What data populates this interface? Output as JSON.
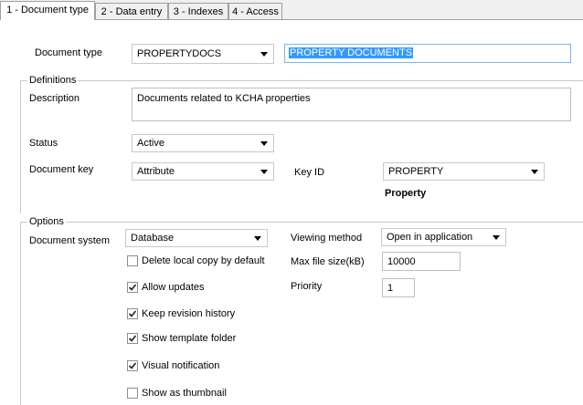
{
  "tabs": [
    {
      "label": "1 - Document type",
      "active": true
    },
    {
      "label": "2 - Data entry",
      "active": false
    },
    {
      "label": "3 - Indexes",
      "active": false
    },
    {
      "label": "4 - Access",
      "active": false
    }
  ],
  "doc_type": {
    "label": "Document type",
    "code": "PROPERTYDOCS",
    "name": "PROPERTY DOCUMENTS"
  },
  "definitions": {
    "legend": "Definitions",
    "description_label": "Description",
    "description_value": "Documents related to KCHA properties",
    "status_label": "Status",
    "status_value": "Active",
    "doc_key_label": "Document key",
    "doc_key_value": "Attribute",
    "key_id_label": "Key ID",
    "key_id_value": "PROPERTY",
    "key_id_caption": "Property"
  },
  "options": {
    "legend": "Options",
    "doc_system_label": "Document system",
    "doc_system_value": "Database",
    "viewing_label": "Viewing method",
    "viewing_value": "Open in application",
    "max_size_label": "Max file size(kB)",
    "max_size_value": "10000",
    "priority_label": "Priority",
    "priority_value": "1",
    "checkboxes": [
      {
        "label": "Delete local copy by default",
        "checked": false
      },
      {
        "label": "Allow updates",
        "checked": true
      },
      {
        "label": "Keep revision history",
        "checked": true
      },
      {
        "label": "Show template folder",
        "checked": true
      },
      {
        "label": "Visual notification",
        "checked": true
      },
      {
        "label": "Show as thumbnail",
        "checked": false
      }
    ]
  },
  "colors": {
    "selection": "#3399ff",
    "focus_border": "#7eb4ea"
  }
}
